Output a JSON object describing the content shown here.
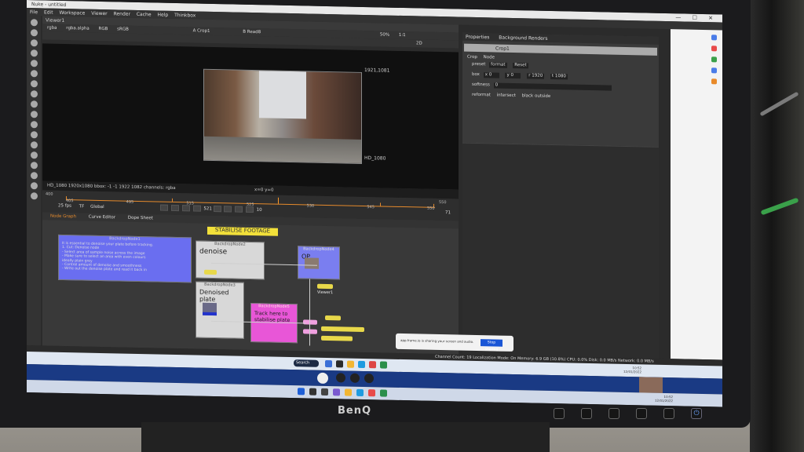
{
  "app": {
    "window_title": "Nuke - untitled",
    "menu": [
      "File",
      "Edit",
      "Workspace",
      "Viewer",
      "Render",
      "Cache",
      "Help",
      "Thinkbox"
    ]
  },
  "viewer": {
    "tab_label": "Viewer1",
    "channels": "rgba",
    "alpha": "rgba.alpha",
    "colorspace_a": "RGB",
    "colorspace_b": "sRGB",
    "input_a": "A Crop1",
    "input_b": "B Read8",
    "zoom": "50%",
    "ratio": "1:1",
    "mode": "2D",
    "top_coord": "1921,1081",
    "bottom_label": "HD_1080",
    "info_line": "HD_1080 1920x1080 bbox: -1 -1 1922 1082 channels: rgba",
    "cursor_readout": "x=0 y=0"
  },
  "timeline": {
    "start": "400",
    "ticks": [
      "405",
      "495",
      "515",
      "525",
      "530",
      "545",
      "550"
    ],
    "end": "550",
    "fps": "25 fps",
    "tf": "TF",
    "range": "Global",
    "current_frame": "521",
    "step": "10",
    "playback_count": "71"
  },
  "properties": {
    "tabs": [
      "Properties",
      "Background Renders"
    ],
    "node_name": "Crop1",
    "subtabs": [
      "Crop",
      "Node"
    ],
    "preset_label": "preset",
    "preset_value": "format",
    "reset_label": "Reset",
    "box_label": "box",
    "box_x": "x 0",
    "box_y": "y 0",
    "box_r": "r 1920",
    "box_t": "t 1080",
    "softness_label": "softness",
    "softness_value": "0",
    "reformat_label": "reformat",
    "intersect_label": "intersect",
    "black_outside_label": "black outside"
  },
  "nodegraph": {
    "tabs": [
      "Node Graph",
      "Curve Editor",
      "Dope Sheet"
    ],
    "sticky": "STABILISE FOOTAGE",
    "note_header": "BackdropNode1",
    "note_lines": [
      "It is essential to denoise your plate before tracking.",
      "1. Cut: Denoise node",
      "- Select area of sample noise across the image",
      "- Make sure to select an area with even colours",
      "  ideally plain grey",
      "- Control amount of denoise and smoothness",
      "- Write out the denoise plate and read it back in"
    ],
    "bd_denoise": "denoise",
    "bd_denoised_plate": "Denoised plate",
    "bd_op": "OP",
    "bd_track": "Track here to stabilise plate",
    "bd_header_a": "BackdropNode2",
    "bd_header_b": "BackdropNode3",
    "bd_header_c": "BackdropNode4",
    "bd_header_d": "BackdropNode5",
    "viewer_node": "Viewer1"
  },
  "share_banner": {
    "text": "app.frame.io is sharing your screen and audio.",
    "stop_label": "Stop sharing"
  },
  "status": {
    "text": "Channel Count: 19 Localization Mode: On Memory: 6.9 GB (10.8%) CPU: 0.0% Disk: 0.0 MB/s Network: 0.0 MB/s"
  },
  "taskbar": {
    "search_label": "Search",
    "time_a": "10:52",
    "date_a": "12/01/2022",
    "time_b": "10:52",
    "date_b": "12/01/2022"
  },
  "monitor": {
    "brand": "BenQ"
  },
  "colors": {
    "node_graph_bg": "#393939",
    "accent_orange": "#e58a2c",
    "sticky_yellow": "#f2e03a",
    "note_blue": "#6a6ef0",
    "track_pink": "#e856d7"
  }
}
